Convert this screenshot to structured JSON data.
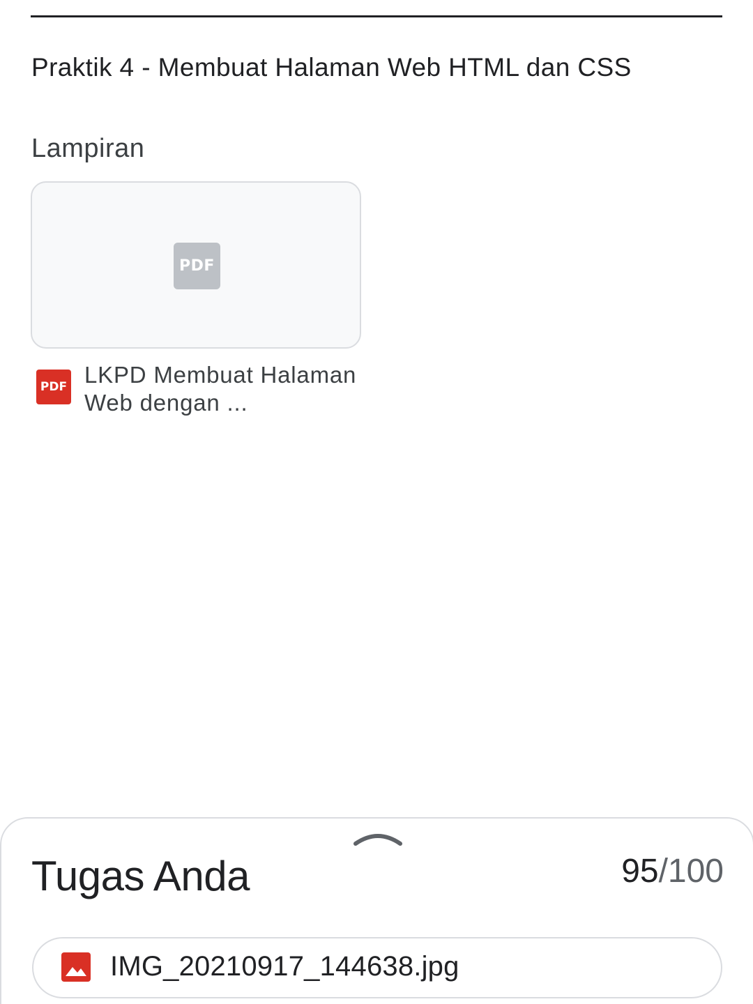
{
  "assignment": {
    "description": "Praktik 4 - Membuat Halaman Web HTML dan CSS"
  },
  "attachments": {
    "heading": "Lampiran",
    "items": [
      {
        "file_type": "PDF",
        "name": "LKPD Membuat Halaman Web dengan ...",
        "icon": "pdf-icon"
      }
    ]
  },
  "your_work": {
    "title": "Tugas Anda",
    "grade_score": "95",
    "grade_max": "/100",
    "expand_icon": "chevron-up-icon",
    "submitted_file": {
      "name": "IMG_20210917_144638.jpg",
      "icon": "image-icon"
    }
  },
  "colors": {
    "pdf_red": "#d93025",
    "pdf_thumbnail_gray": "#bdc1c6",
    "border": "#dadce0",
    "text_primary": "#202124",
    "text_secondary": "#5f6368"
  }
}
